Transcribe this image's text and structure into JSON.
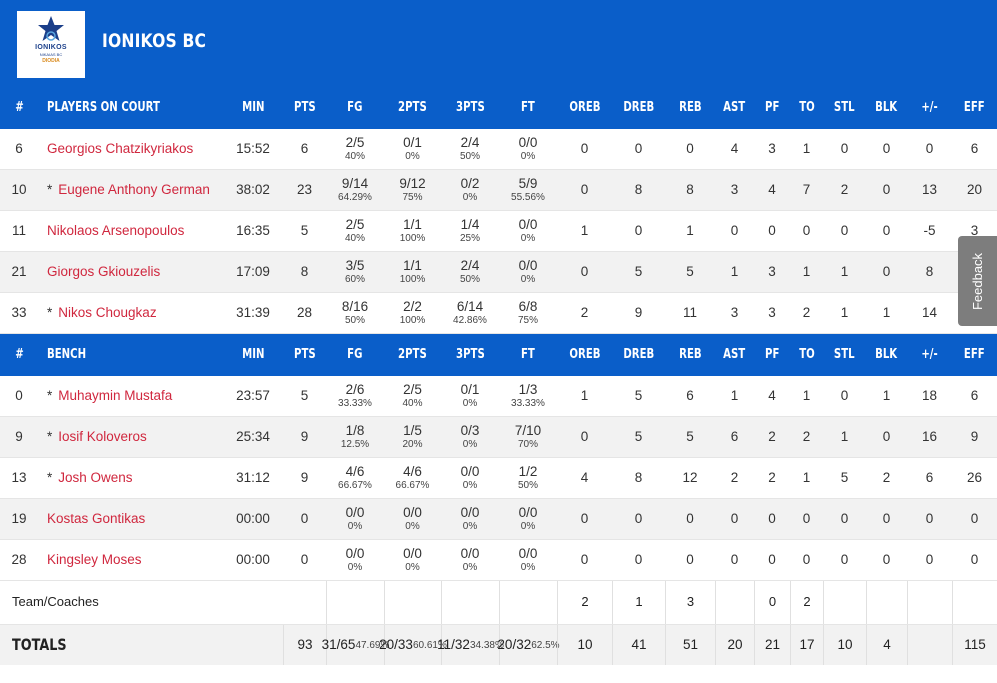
{
  "team": {
    "name": "IONIKOS BC",
    "logo_text": "IONIKOS",
    "logo_sub": "NIKAIAS BC",
    "logo_sponsor": "DIODIA",
    "brand_color": "#0a5ec9",
    "name_color": "#d0273e"
  },
  "headers": {
    "num": "#",
    "on_court": "PLAYERS ON COURT",
    "bench": "BENCH",
    "min": "MIN",
    "pts": "PTS",
    "fg": "FG",
    "p2": "2PTS",
    "p3": "3PTS",
    "ft": "FT",
    "oreb": "OREB",
    "dreb": "DREB",
    "reb": "REB",
    "ast": "AST",
    "pf": "PF",
    "to": "TO",
    "stl": "STL",
    "blk": "BLK",
    "pm": "+/-",
    "eff": "EFF"
  },
  "on_court": [
    {
      "num": "6",
      "star": "",
      "name": "Georgios Chatzikyriakos",
      "min": "15:52",
      "pts": "6",
      "fg": "2/5",
      "fg_pct": "40%",
      "p2": "0/1",
      "p2_pct": "0%",
      "p3": "2/4",
      "p3_pct": "50%",
      "ft": "0/0",
      "ft_pct": "0%",
      "oreb": "0",
      "dreb": "0",
      "reb": "0",
      "ast": "4",
      "pf": "3",
      "to": "1",
      "stl": "0",
      "blk": "0",
      "pm": "0",
      "eff": "6"
    },
    {
      "num": "10",
      "star": "*",
      "name": "Eugene Anthony German",
      "min": "38:02",
      "pts": "23",
      "fg": "9/14",
      "fg_pct": "64.29%",
      "p2": "9/12",
      "p2_pct": "75%",
      "p3": "0/2",
      "p3_pct": "0%",
      "ft": "5/9",
      "ft_pct": "55.56%",
      "oreb": "0",
      "dreb": "8",
      "reb": "8",
      "ast": "3",
      "pf": "4",
      "to": "7",
      "stl": "2",
      "blk": "0",
      "pm": "13",
      "eff": "20"
    },
    {
      "num": "11",
      "star": "",
      "name": "Nikolaos Arsenopoulos",
      "min": "16:35",
      "pts": "5",
      "fg": "2/5",
      "fg_pct": "40%",
      "p2": "1/1",
      "p2_pct": "100%",
      "p3": "1/4",
      "p3_pct": "25%",
      "ft": "0/0",
      "ft_pct": "0%",
      "oreb": "1",
      "dreb": "0",
      "reb": "1",
      "ast": "0",
      "pf": "0",
      "to": "0",
      "stl": "0",
      "blk": "0",
      "pm": "-5",
      "eff": "3"
    },
    {
      "num": "21",
      "star": "",
      "name": "Giorgos Gkiouzelis",
      "min": "17:09",
      "pts": "8",
      "fg": "3/5",
      "fg_pct": "60%",
      "p2": "1/1",
      "p2_pct": "100%",
      "p3": "2/4",
      "p3_pct": "50%",
      "ft": "0/0",
      "ft_pct": "0%",
      "oreb": "0",
      "dreb": "5",
      "reb": "5",
      "ast": "1",
      "pf": "3",
      "to": "1",
      "stl": "1",
      "blk": "0",
      "pm": "8",
      "eff": ""
    },
    {
      "num": "33",
      "star": "*",
      "name": "Nikos Chougkaz",
      "min": "31:39",
      "pts": "28",
      "fg": "8/16",
      "fg_pct": "50%",
      "p2": "2/2",
      "p2_pct": "100%",
      "p3": "6/14",
      "p3_pct": "42.86%",
      "ft": "6/8",
      "ft_pct": "75%",
      "oreb": "2",
      "dreb": "9",
      "reb": "11",
      "ast": "3",
      "pf": "3",
      "to": "2",
      "stl": "1",
      "blk": "1",
      "pm": "14",
      "eff": ""
    }
  ],
  "bench": [
    {
      "num": "0",
      "star": "*",
      "name": "Muhaymin Mustafa",
      "min": "23:57",
      "pts": "5",
      "fg": "2/6",
      "fg_pct": "33.33%",
      "p2": "2/5",
      "p2_pct": "40%",
      "p3": "0/1",
      "p3_pct": "0%",
      "ft": "1/3",
      "ft_pct": "33.33%",
      "oreb": "1",
      "dreb": "5",
      "reb": "6",
      "ast": "1",
      "pf": "4",
      "to": "1",
      "stl": "0",
      "blk": "1",
      "pm": "18",
      "eff": "6"
    },
    {
      "num": "9",
      "star": "*",
      "name": "Iosif Koloveros",
      "min": "25:34",
      "pts": "9",
      "fg": "1/8",
      "fg_pct": "12.5%",
      "p2": "1/5",
      "p2_pct": "20%",
      "p3": "0/3",
      "p3_pct": "0%",
      "ft": "7/10",
      "ft_pct": "70%",
      "oreb": "0",
      "dreb": "5",
      "reb": "5",
      "ast": "6",
      "pf": "2",
      "to": "2",
      "stl": "1",
      "blk": "0",
      "pm": "16",
      "eff": "9"
    },
    {
      "num": "13",
      "star": "*",
      "name": "Josh Owens",
      "min": "31:12",
      "pts": "9",
      "fg": "4/6",
      "fg_pct": "66.67%",
      "p2": "4/6",
      "p2_pct": "66.67%",
      "p3": "0/0",
      "p3_pct": "0%",
      "ft": "1/2",
      "ft_pct": "50%",
      "oreb": "4",
      "dreb": "8",
      "reb": "12",
      "ast": "2",
      "pf": "2",
      "to": "1",
      "stl": "5",
      "blk": "2",
      "pm": "6",
      "eff": "26"
    },
    {
      "num": "19",
      "star": "",
      "name": "Kostas Gontikas",
      "min": "00:00",
      "pts": "0",
      "fg": "0/0",
      "fg_pct": "0%",
      "p2": "0/0",
      "p2_pct": "0%",
      "p3": "0/0",
      "p3_pct": "0%",
      "ft": "0/0",
      "ft_pct": "0%",
      "oreb": "0",
      "dreb": "0",
      "reb": "0",
      "ast": "0",
      "pf": "0",
      "to": "0",
      "stl": "0",
      "blk": "0",
      "pm": "0",
      "eff": "0"
    },
    {
      "num": "28",
      "star": "",
      "name": "Kingsley Moses",
      "min": "00:00",
      "pts": "0",
      "fg": "0/0",
      "fg_pct": "0%",
      "p2": "0/0",
      "p2_pct": "0%",
      "p3": "0/0",
      "p3_pct": "0%",
      "ft": "0/0",
      "ft_pct": "0%",
      "oreb": "0",
      "dreb": "0",
      "reb": "0",
      "ast": "0",
      "pf": "0",
      "to": "0",
      "stl": "0",
      "blk": "0",
      "pm": "0",
      "eff": "0"
    }
  ],
  "team_coaches": {
    "label": "Team/Coaches",
    "oreb": "2",
    "dreb": "1",
    "reb": "3",
    "pf": "0",
    "to": "2"
  },
  "totals": {
    "label": "TOTALS",
    "pts": "93",
    "fg": "31/65",
    "fg_pct": "47.69%",
    "p2": "20/33",
    "p2_pct": "60.61%",
    "p3": "11/32",
    "p3_pct": "34.38%",
    "ft": "20/32",
    "ft_pct": "62.5%",
    "oreb": "10",
    "dreb": "41",
    "reb": "51",
    "ast": "20",
    "pf": "21",
    "to": "17",
    "stl": "10",
    "blk": "4",
    "pm": "",
    "eff": "115"
  },
  "feedback_label": "Feedback"
}
